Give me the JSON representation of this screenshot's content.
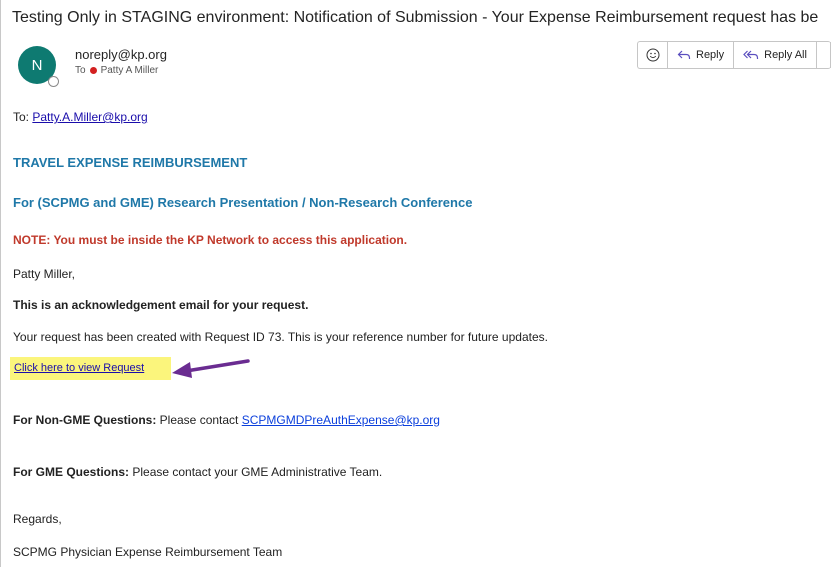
{
  "email": {
    "subject": "Testing Only in STAGING environment: Notification of Submission - Your Expense Reimbursement request has be",
    "avatar_initial": "N",
    "sender": "noreply@kp.org",
    "to_prefix": "To",
    "to_name": "Patty A Miller"
  },
  "actions": {
    "reply_label": "Reply",
    "reply_all_label": "Reply All"
  },
  "body": {
    "to_label": "To: ",
    "to_email": "Patty.A.Miller@kp.org",
    "heading1": "TRAVEL EXPENSE REIMBURSEMENT",
    "heading2": "For (SCPMG and GME) Research Presentation / Non-Research Conference",
    "note": "NOTE: You must be inside the KP Network to access this application.",
    "greeting": "Patty Miller,",
    "ack": "This is an acknowledgement email for your request.",
    "request_text": "Your request has been created with Request ID 73. This is your reference number for future updates.",
    "view_link": "Click here to view Request",
    "nongme_label": "For Non-GME Questions:",
    "nongme_text": " Please contact ",
    "nongme_email": "SCPMGMDPreAuthExpense@kp.org",
    "gme_label": "For GME Questions:",
    "gme_text": " Please contact your GME Administrative Team.",
    "regards": "Regards,",
    "team": "SCPMG Physician Expense Reimbursement Team"
  },
  "colors": {
    "avatar": "#0e7a71",
    "heading": "#1f78a8",
    "note": "#c0392b",
    "highlight": "#fbf57c",
    "arrow": "#6a2c91"
  }
}
